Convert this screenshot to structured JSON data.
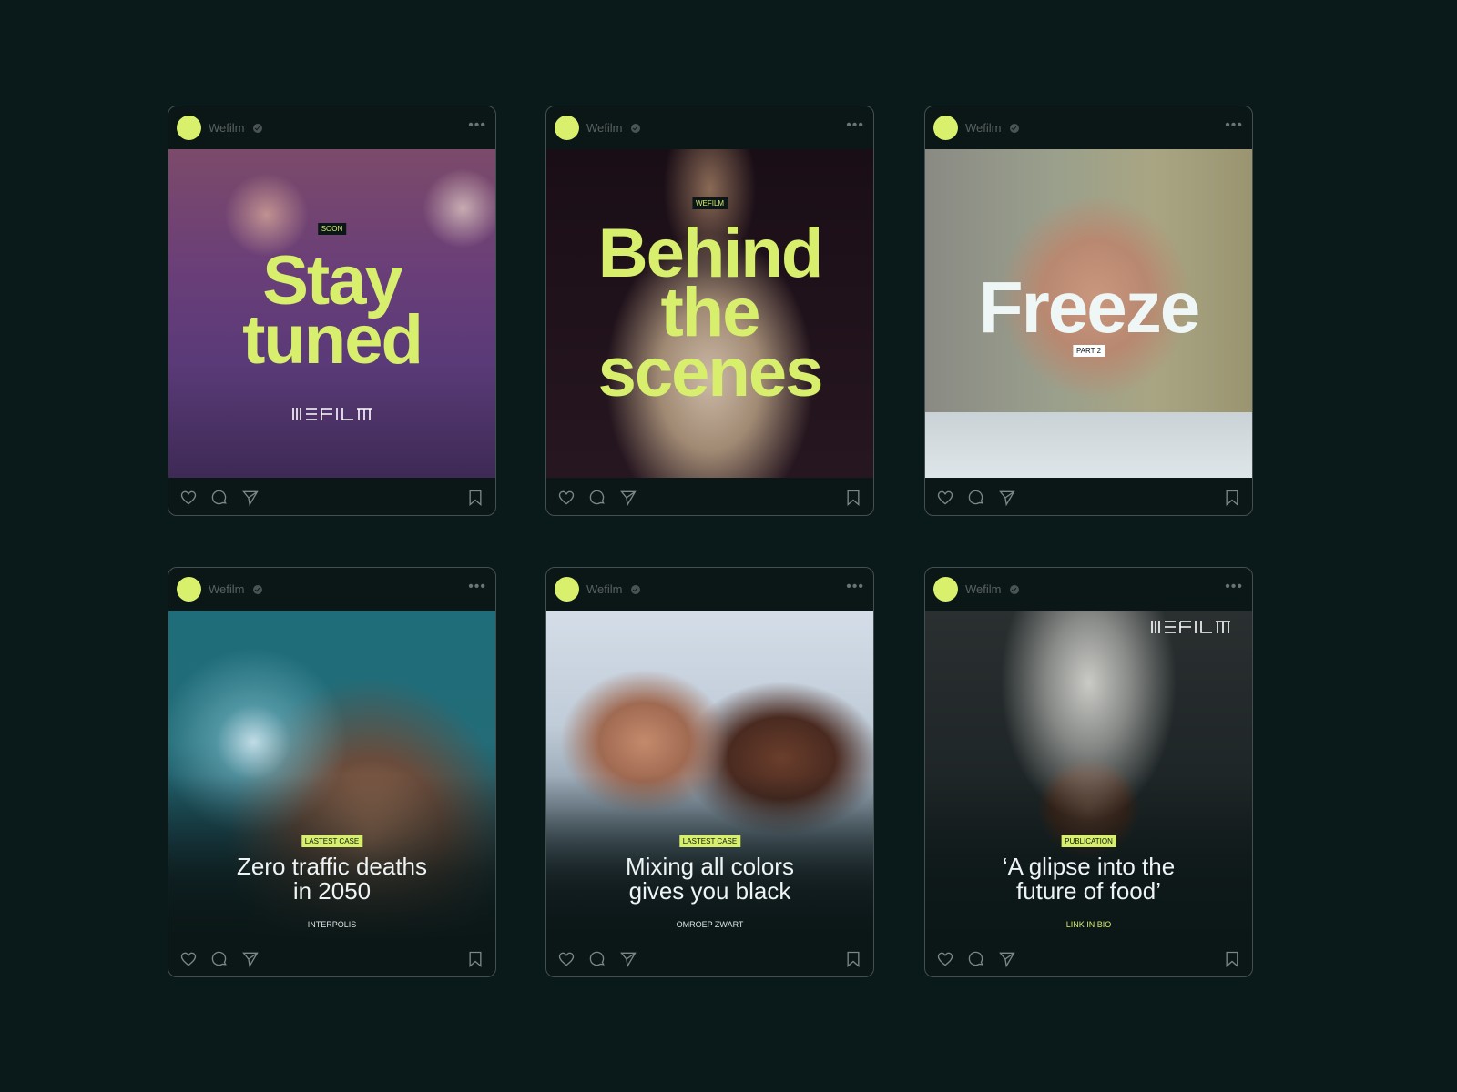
{
  "account": {
    "name": "Wefilm"
  },
  "logo_text": "WEFILM",
  "posts": [
    {
      "tag": "SOON",
      "title_line1": "Stay",
      "title_line2": "tuned"
    },
    {
      "tag": "WEFILM",
      "title_line1": "Behind",
      "title_line2": "the",
      "title_line3": "scenes"
    },
    {
      "title": "Freeze",
      "tag": "PART 2"
    },
    {
      "tag": "LASTEST CASE",
      "headline_line1": "Zero traffic deaths",
      "headline_line2": "in 2050",
      "client": "INTERPOLIS"
    },
    {
      "tag": "LASTEST CASE",
      "headline_line1": "Mixing all colors",
      "headline_line2": "gives you black",
      "client": "OMROEP ZWART"
    },
    {
      "tag": "PUBLICATION",
      "headline_line1": "‘A glipse into the",
      "headline_line2": "future of food’",
      "client": "LINK IN BIO"
    }
  ],
  "colors": {
    "background": "#0a1a1a",
    "accent": "#d8ef6d",
    "card_border": "#43504f"
  },
  "icons": [
    "heart-icon",
    "comment-icon",
    "share-icon",
    "bookmark-icon",
    "more-icon",
    "verified-icon"
  ]
}
